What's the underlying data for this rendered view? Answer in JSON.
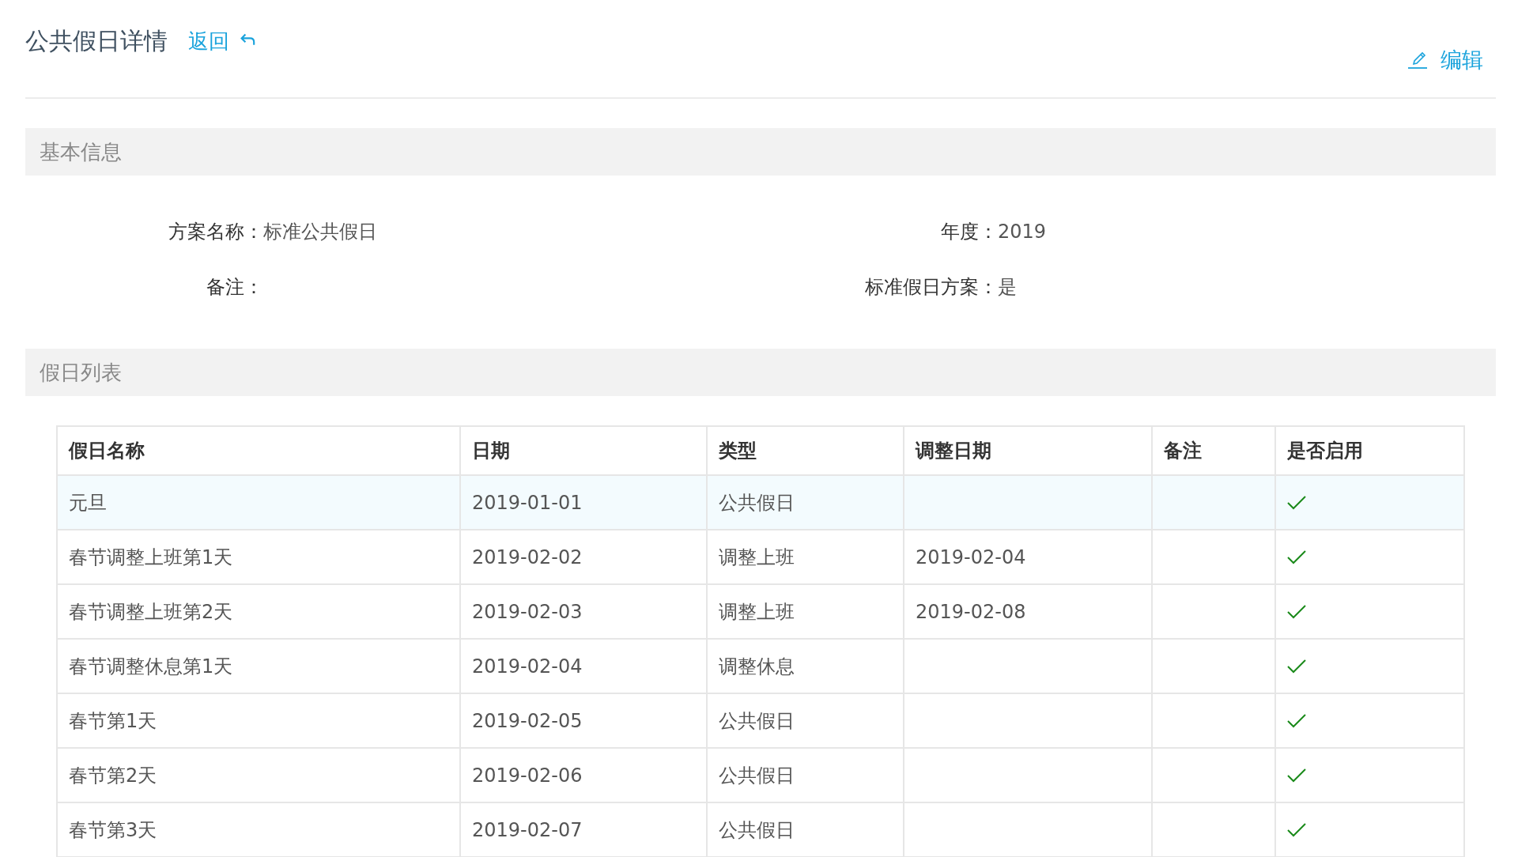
{
  "header": {
    "title": "公共假日详情",
    "back_link": "返回",
    "edit_button": "编辑"
  },
  "basic_info": {
    "title": "基本信息",
    "fields": [
      {
        "label": "方案名称：",
        "value": "标准公共假日"
      },
      {
        "label": "年度：",
        "value": "2019"
      },
      {
        "label": "备注："
      },
      {
        "label": "标准假日方案：",
        "value": "是"
      }
    ]
  },
  "holiday_list": {
    "title": "假日列表",
    "columns": [
      "假日名称",
      "日期",
      "类型",
      "调整日期",
      "备注",
      "是否启用"
    ],
    "rows": [
      {
        "name": "元旦",
        "date": "2019-01-01",
        "type": "公共假日",
        "enabled": true,
        "selected": true
      },
      {
        "name": "春节调整上班第1天",
        "date": "2019-02-02",
        "type": "调整上班",
        "adjust_date": "2019-02-04",
        "enabled": true,
        "selected": false
      },
      {
        "name": "春节调整上班第2天",
        "date": "2019-02-03",
        "type": "调整上班",
        "adjust_date": "2019-02-08",
        "enabled": true,
        "selected": false
      },
      {
        "name": "春节调整休息第1天",
        "date": "2019-02-04",
        "type": "调整休息",
        "enabled": true,
        "selected": false
      },
      {
        "name": "春节第1天",
        "date": "2019-02-05",
        "type": "公共假日",
        "enabled": true,
        "selected": false
      },
      {
        "name": "春节第2天",
        "date": "2019-02-06",
        "type": "公共假日",
        "enabled": true,
        "selected": false
      },
      {
        "name": "春节第3天",
        "date": "2019-02-07",
        "type": "公共假日",
        "enabled": true,
        "selected": false
      }
    ]
  }
}
